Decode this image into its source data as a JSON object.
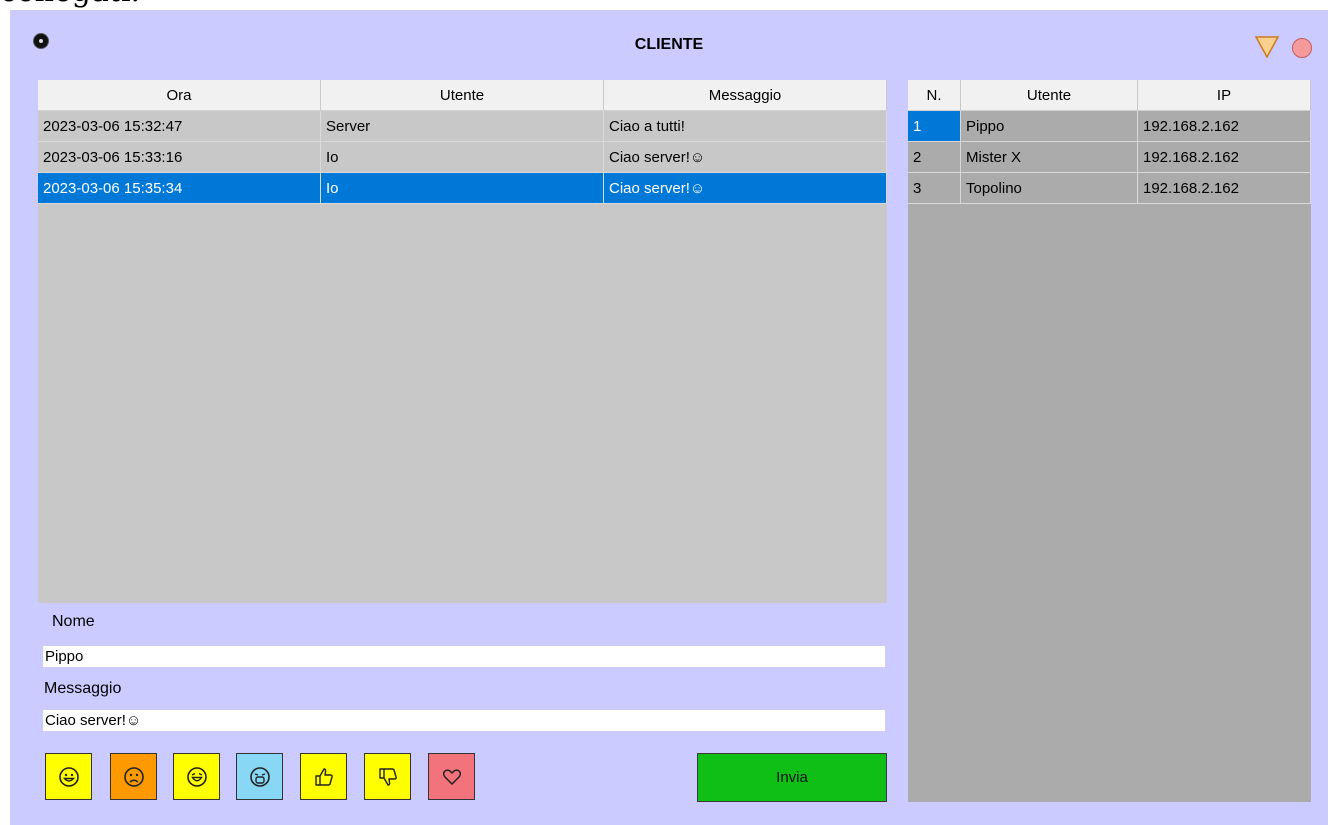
{
  "page_top_text": "collegati.",
  "window": {
    "title": "CLIENTE",
    "bg_color": "#cccbff"
  },
  "chat_table": {
    "columns": [
      "Ora",
      "Utente",
      "Messaggio"
    ],
    "rows": [
      {
        "time": "2023-03-06 15:32:47",
        "user": "Server",
        "message": "Ciao a tutti!",
        "selected": false
      },
      {
        "time": "2023-03-06 15:33:16",
        "user": "Io",
        "message": "Ciao server!☺",
        "selected": false
      },
      {
        "time": "2023-03-06 15:35:34",
        "user": "Io",
        "message": "Ciao server!☺",
        "selected": true
      }
    ]
  },
  "users_table": {
    "columns": [
      "N.",
      "Utente",
      "IP"
    ],
    "rows": [
      {
        "n": "1",
        "user": "Pippo",
        "ip": "192.168.2.162"
      },
      {
        "n": "2",
        "user": "Mister X",
        "ip": "192.168.2.162"
      },
      {
        "n": "3",
        "user": "Topolino",
        "ip": "192.168.2.162"
      }
    ]
  },
  "form": {
    "name_label": "Nome",
    "name_value": "Pippo",
    "message_label": "Messaggio",
    "message_value": "Ciao server!☺"
  },
  "emoji_buttons": [
    {
      "icon": "smile-icon",
      "color": "#ffff00"
    },
    {
      "icon": "sad-icon",
      "color": "#ff9900"
    },
    {
      "icon": "laugh-icon",
      "color": "#ffff00"
    },
    {
      "icon": "cry-icon",
      "color": "#87d7f5"
    },
    {
      "icon": "thumbs-up-icon",
      "color": "#ffff00"
    },
    {
      "icon": "thumbs-down-icon",
      "color": "#ffff00"
    },
    {
      "icon": "heart-icon",
      "color": "#f2737b"
    }
  ],
  "send_button": {
    "label": "Invia",
    "color": "#0fbf16"
  },
  "selection_color": "#0078d7"
}
